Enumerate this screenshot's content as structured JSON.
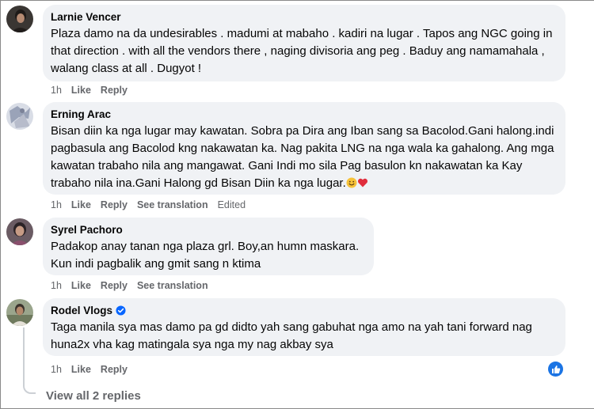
{
  "comments": [
    {
      "author": "Larnie Vencer",
      "text": "Plaza damo na da undesirables . madumi at mabaho . kadiri na lugar . Tapos ang NGC going in that direction . with all the vendors there , naging divisoria ang peg . Baduy ang namamahala , walang class at all . Dugyot !",
      "time": "1h",
      "like_label": "Like",
      "reply_label": "Reply"
    },
    {
      "author": "Erning Arac",
      "text": "Bisan diin ka nga lugar may kawatan. Sobra pa Dira ang Iban sang sa Bacolod.Gani halong.indi pagbasula ang Bacolod kng nakawatan ka. Nag pakita LNG na nga wala ka gahalong. Ang mga kawatan trabaho nila ang mangawat. Gani Indi mo sila Pag basulon kn nakawatan ka Kay trabaho nila ina.Gani Halong gd Bisan Diin ka nga lugar.",
      "time": "1h",
      "like_label": "Like",
      "reply_label": "Reply",
      "translate_label": "See translation",
      "edited_label": "Edited",
      "emojis": [
        "grinning-face-emoji",
        "red-heart-emoji"
      ]
    },
    {
      "author": "Syrel Pachoro",
      "text": "Padakop anay tanan nga plaza grl. Boy,an humn maskara. Kun indi pagbalik ang gmit sang n ktima",
      "time": "1h",
      "like_label": "Like",
      "reply_label": "Reply",
      "translate_label": "See translation"
    },
    {
      "author": "Rodel Vlogs",
      "verified": true,
      "text": "Taga manila sya mas damo pa gd didto yah sang gabuhat nga amo na yah tani forward nag huna2x vha kag matingala sya nga my nag akbay sya",
      "time": "1h",
      "like_label": "Like",
      "reply_label": "Reply",
      "reaction_icon": "like-icon"
    }
  ],
  "view_replies_label": "View all 2 replies",
  "colors": {
    "bubble": "#f0f2f5",
    "meta_text": "#65676b",
    "like_blue": "#1b74e4",
    "verified_blue": "#0866ff"
  }
}
